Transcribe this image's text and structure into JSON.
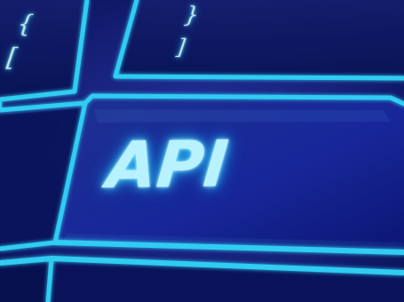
{
  "photo": {
    "main_label": "API",
    "glyphs": [
      "{",
      "[",
      "}",
      "]"
    ],
    "colors": {
      "background_dark": "#06104a",
      "background_mid": "#1a2d95",
      "key_glow": "#31d9ff",
      "text_glow": "#b9f2ff"
    }
  }
}
